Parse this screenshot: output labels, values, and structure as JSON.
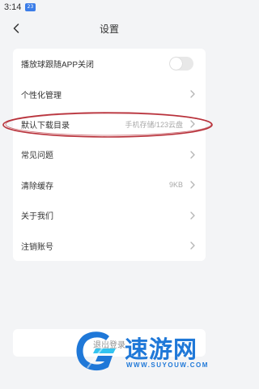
{
  "status_bar": {
    "time": "3:14",
    "badge": "23"
  },
  "header": {
    "back_icon": "chevron-left-icon",
    "title": "设置"
  },
  "settings": {
    "items": [
      {
        "label": "播放球跟随APP关闭",
        "control": "toggle",
        "toggle_on": false
      },
      {
        "label": "个性化管理",
        "control": "chevron"
      },
      {
        "label": "默认下载目录",
        "value": "手机存储/123云盘",
        "control": "chevron"
      },
      {
        "label": "常见问题",
        "control": "chevron"
      },
      {
        "label": "清除缓存",
        "value": "9KB",
        "control": "chevron"
      },
      {
        "label": "关于我们",
        "control": "chevron"
      },
      {
        "label": "注销账号",
        "control": "chevron"
      }
    ]
  },
  "logout": {
    "label": "退出登录"
  },
  "watermark": {
    "title": "速游网",
    "url": "WWW.SUYOUW.COM"
  },
  "colors": {
    "background": "#f3f4f6",
    "card": "#ffffff",
    "text": "#333333",
    "secondary_text": "#a9a9a9",
    "highlight_ellipse": "#b8313a",
    "watermark": "#1f78d8"
  }
}
